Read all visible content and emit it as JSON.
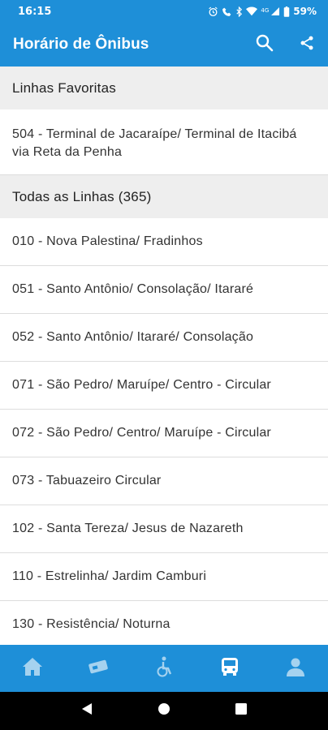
{
  "status_bar": {
    "time": "16:15",
    "network": "4G",
    "battery": "59%",
    "icons": [
      "alarm-icon",
      "wifi-calling-icon",
      "bluetooth-icon",
      "wifi-icon",
      "signal-icon",
      "battery-icon"
    ]
  },
  "app_bar": {
    "title": "Horário de Ônibus",
    "actions": [
      "search-icon",
      "share-icon"
    ]
  },
  "favorites": {
    "header": "Linhas Favoritas",
    "items": [
      {
        "label": "504 - Terminal de Jacaraípe/ Terminal de Itacibá via Reta da Penha"
      }
    ]
  },
  "all_lines": {
    "header": "Todas as Linhas (365)",
    "items": [
      {
        "label": "010 - Nova Palestina/ Fradinhos"
      },
      {
        "label": "051 - Santo Antônio/ Consolação/ Itararé"
      },
      {
        "label": "052 - Santo Antônio/ Itararé/ Consolação"
      },
      {
        "label": "071 - São Pedro/ Maruípe/ Centro - Circular"
      },
      {
        "label": "072 - São Pedro/ Centro/ Maruípe - Circular"
      },
      {
        "label": "073 - Tabuazeiro Circular"
      },
      {
        "label": "102 - Santa Tereza/ Jesus de Nazareth"
      },
      {
        "label": "110 - Estrelinha/ Jardim Camburi"
      },
      {
        "label": "130 - Resistência/ Noturna"
      }
    ]
  },
  "bottom_nav": {
    "items": [
      "home-icon",
      "ticket-icon",
      "accessibility-icon",
      "bus-icon",
      "profile-icon"
    ],
    "active": "bus-icon"
  },
  "system_nav": [
    "back-icon",
    "home-circle-icon",
    "recents-icon"
  ],
  "colors": {
    "primary": "#1e8fd8",
    "section_bg": "#eeeeee",
    "text": "#333333",
    "divider": "#dddddd"
  }
}
